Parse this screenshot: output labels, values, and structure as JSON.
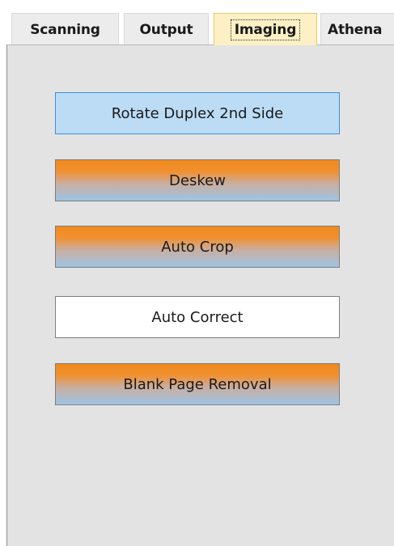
{
  "tabs": [
    {
      "label": "Scanning",
      "selected": false
    },
    {
      "label": "Output",
      "selected": false
    },
    {
      "label": "Imaging",
      "selected": true
    },
    {
      "label": "Athena",
      "selected": false
    }
  ],
  "imaging": {
    "buttons": [
      {
        "label": "Rotate Duplex 2nd Side",
        "state": "selected"
      },
      {
        "label": "Deskew",
        "state": "enabled"
      },
      {
        "label": "Auto Crop",
        "state": "enabled"
      },
      {
        "label": "Auto Correct",
        "state": "disabled"
      },
      {
        "label": "Blank Page Removal",
        "state": "enabled"
      }
    ]
  },
  "colors": {
    "selected_fill": "#bcdcf6",
    "selected_border": "#3c8fd9",
    "active_top": "#f08a1c",
    "active_bottom": "#9ec4e4",
    "selected_tab_fill": "#fdf0c4",
    "panel_bg": "#e3e3e3"
  }
}
